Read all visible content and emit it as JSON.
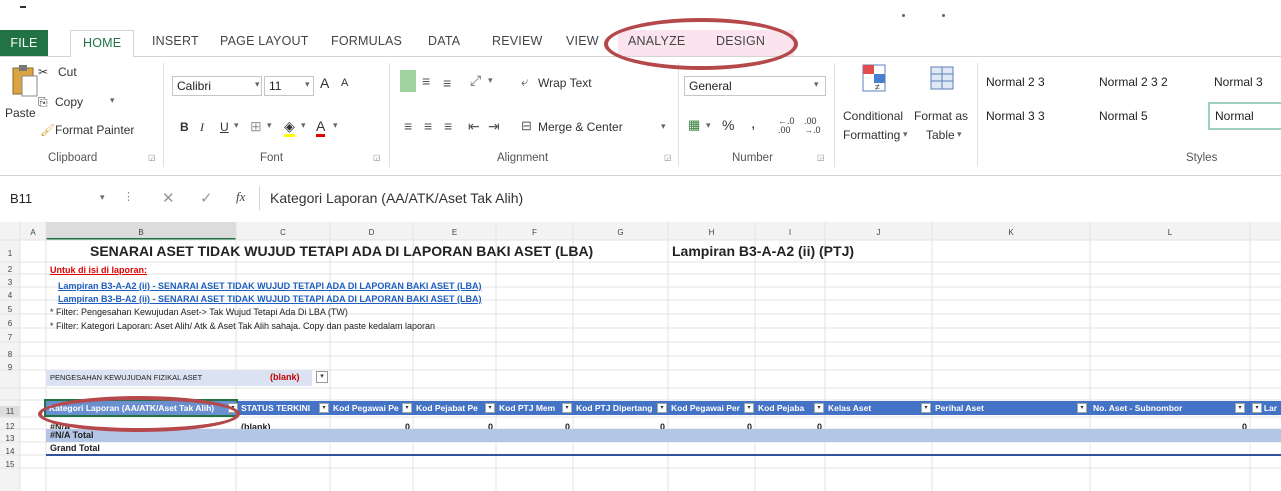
{
  "ribbon_tabs": {
    "file": "FILE",
    "home": "HOME",
    "insert": "INSERT",
    "page_layout": "PAGE LAYOUT",
    "formulas": "FORMULAS",
    "data": "DATA",
    "review": "REVIEW",
    "view": "VIEW",
    "analyze": "ANALYZE",
    "design": "DESIGN"
  },
  "clipboard": {
    "paste": "Paste",
    "cut": "Cut",
    "copy": "Copy",
    "format_painter": "Format Painter",
    "group": "Clipboard"
  },
  "font": {
    "name": "Calibri",
    "size": "11",
    "bold": "B",
    "italic": "I",
    "underline": "U",
    "group": "Font",
    "grow": "A",
    "shrink": "A",
    "color_letter": "A"
  },
  "alignment": {
    "wrap_text": "Wrap Text",
    "merge_center": "Merge & Center",
    "group": "Alignment"
  },
  "number": {
    "format": "General",
    "percent": "%",
    "comma": ",",
    "inc_dec": "←.0 .00",
    "dec_dec": ".00 →.0",
    "group": "Number"
  },
  "styles": {
    "conditional": "Conditional",
    "formatting": "Formatting",
    "format_as": "Format as",
    "table": "Table",
    "cells": [
      "Normal 2 3",
      "Normal 2 3 2",
      "Normal 3",
      "Normal 3 3",
      "Normal 5",
      "Normal"
    ],
    "group": "Styles"
  },
  "formula_bar": {
    "name_box": "B11",
    "fx": "fx",
    "content": "Kategori Laporan (AA/ATK/Aset Tak Alih)"
  },
  "columns": [
    "A",
    "B",
    "C",
    "D",
    "E",
    "F",
    "G",
    "H",
    "I",
    "J",
    "K",
    "L"
  ],
  "rows": [
    "1",
    "2",
    "3",
    "4",
    "5",
    "6",
    "7",
    "8",
    "9",
    "11",
    "12",
    "13",
    "14",
    "15"
  ],
  "sheet": {
    "title": "SENARAI ASET TIDAK WUJUD TETAPI ADA DI LAPORAN BAKI ASET (LBA)",
    "lampiran": "Lampiran B3-A-A2 (ii) (PTJ)",
    "note": "Untuk di isi di laporan:",
    "link1": "Lampiran B3-A-A2 (ii) - SENARAI ASET TIDAK WUJUD TETAPI ADA DI LAPORAN BAKI ASET (LBA)",
    "link2": "Lampiran B3-B-A2 (ii) - SENARAI ASET TIDAK WUJUD TETAPI ADA DI LAPORAN BAKI ASET (LBA)",
    "filter1": "* Filter: Pengesahan Kewujudan Aset-> Tak Wujud Tetapi Ada Di LBA (TW)",
    "filter2": "* Filter: Kategori Laporan: Aset Alih/ Atk & Aset Tak Alih sahaja. Copy dan paste kedalam laporan",
    "filter_label": "PENGESAHAN KEWUJUDAN FIZIKAL ASET",
    "filter_value": "(blank)"
  },
  "pivot_headers": [
    "Kategori Laporan (AA/ATK/Aset Tak Alih)",
    "STATUS TERKINI",
    "Kod Pegawai Pe",
    "Kod Pejabat Pe",
    "Kod PTJ Mem",
    "Kod PTJ Dipertang",
    "Kod Pegawai Per",
    "Kod Pejaba",
    "Kelas Aset",
    "Perihal Aset",
    "No. Aset - Subnombor",
    "ID Lar"
  ],
  "pivot_row12": {
    "label": "#N/A",
    "status": "(blank)",
    "zeros": [
      "0",
      "0",
      "0",
      "0",
      "0",
      "0",
      "0"
    ]
  },
  "pivot_row13": "#N/A Total",
  "pivot_row14": "Grand Total"
}
